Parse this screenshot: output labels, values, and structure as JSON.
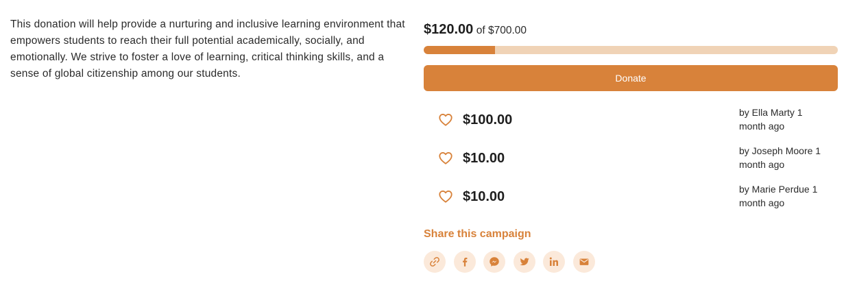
{
  "campaign": {
    "description": "This donation will help provide a nurturing and inclusive learning environment that empowers students to reach their full potential academically, socially, and emotionally. We strive to foster a love of learning, critical thinking skills, and a sense of global citizenship among our students."
  },
  "progress": {
    "raised": "$120.00",
    "goal_text": "of $700.00",
    "fraction": 0.1714
  },
  "donate_button": {
    "label": "Donate"
  },
  "donations": [
    {
      "amount": "$100.00",
      "by": "by Ella Marty 1 month ago",
      "icon": "heart-icon"
    },
    {
      "amount": "$10.00",
      "by": "by Joseph Moore 1 month ago",
      "icon": "heart-icon"
    },
    {
      "amount": "$10.00",
      "by": "by Marie Perdue 1 month ago",
      "icon": "heart-icon"
    }
  ],
  "share": {
    "title": "Share this campaign",
    "icons": [
      "link-icon",
      "facebook-icon",
      "messenger-icon",
      "twitter-icon",
      "linkedin-icon",
      "email-icon"
    ]
  },
  "colors": {
    "accent": "#d8823a",
    "accent_light": "#f0d3b6",
    "icon_bg": "#fbe9da"
  }
}
